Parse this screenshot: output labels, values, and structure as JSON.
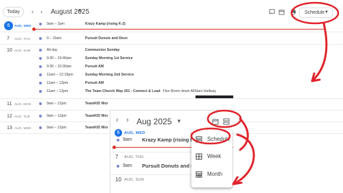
{
  "toolbar": {
    "today_label": "Today",
    "prev_icon": "chevron-left-icon",
    "next_icon": "chevron-right-icon",
    "month_label": "August 2025",
    "view_label": "Schedule",
    "accent_color": "#1a73e8"
  },
  "days": [
    {
      "num": "6",
      "label": "AUG, WED",
      "is_today": true,
      "events": [
        {
          "time": "9am – 2pm",
          "title": "Krazy Kamp (rising K-2)",
          "location": ""
        }
      ]
    },
    {
      "num": "7",
      "label": "AUG, THU",
      "events": [
        {
          "time": "9 – 10am",
          "title": "Pursuit Donuts and Devo",
          "location": ""
        }
      ]
    },
    {
      "num": "10",
      "label": "AUG, SUN",
      "events": [
        {
          "time": "All day",
          "title": "Communion Sunday",
          "location": ""
        },
        {
          "time": "9:30 – 10:40am",
          "title": "Sunday Morning 1st Service",
          "location": ""
        },
        {
          "time": "9:30 – 10:30am",
          "title": "Pursuit AM",
          "location": ""
        },
        {
          "time": "11am – 12:15pm",
          "title": "Sunday Morning 2nd Service",
          "location": ""
        },
        {
          "time": "11am – 12pm",
          "title": "Pursuit AM",
          "location": ""
        },
        {
          "time": "11am – 12pm",
          "title": "The Team Church Way 201 - Connect & Lead",
          "location": "Flex Room down AllStars Hallway"
        }
      ]
    },
    {
      "num": "11",
      "label": "AUG, MON",
      "events": [
        {
          "time": "9am – 12pm",
          "title": "TeamKID Wor",
          "location": ""
        }
      ]
    },
    {
      "num": "12",
      "label": "AUG, TUE",
      "events": [
        {
          "time": "9am – 12pm",
          "title": "TeamKID Wor",
          "location": ""
        }
      ]
    },
    {
      "num": "13",
      "label": "AUG, WED",
      "events": [
        {
          "time": "9am – 12pm",
          "title": "TeamKID Wor",
          "location": ""
        }
      ]
    }
  ],
  "inset": {
    "month_label": "Aug 2025",
    "days": [
      {
        "num": "6",
        "label": "AUG, WED",
        "is_today": true,
        "event_time": "9am",
        "event_title": "Krazy Kamp (rising K-"
      },
      {
        "num": "7",
        "label": "AUG, THU",
        "event_time": "9am",
        "event_title": "Pursuit Donuts and De"
      },
      {
        "num": "10",
        "label": "AUG, SUN"
      }
    ],
    "menu": [
      {
        "label": "Schedule",
        "icon": "schedule-view-icon"
      },
      {
        "label": "Week",
        "icon": "week-grid-icon"
      },
      {
        "label": "Month",
        "icon": "month-calendar-icon"
      }
    ]
  },
  "colors": {
    "event_dot": "#7986cb",
    "now_line": "#d93025",
    "annotation": "#e0242b"
  }
}
